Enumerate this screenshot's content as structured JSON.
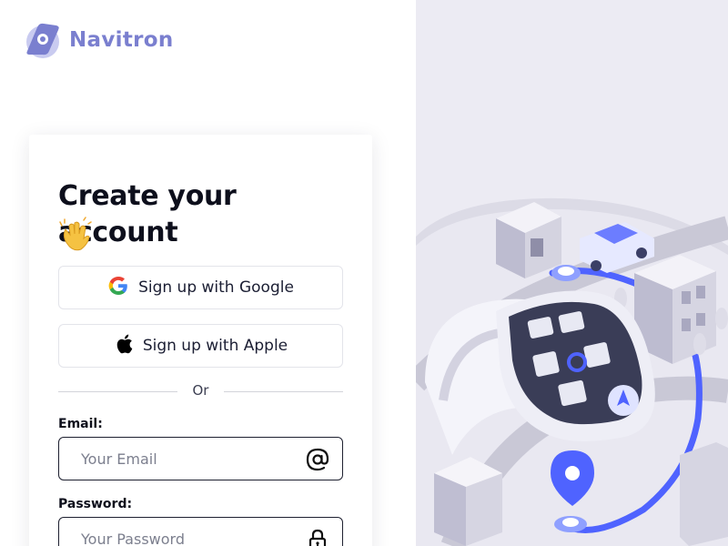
{
  "brand": {
    "name": "Navitron",
    "logo_icon": "navitron-logo-icon",
    "color": "#7a7fcf"
  },
  "signup": {
    "title": "Create your account",
    "title_emoji_icon": "clapping-hands-icon",
    "google_button": {
      "label": "Sign up with Google",
      "icon": "google-icon"
    },
    "apple_button": {
      "label": "Sign up with Apple",
      "icon": "apple-icon"
    },
    "divider_text": "Or",
    "email": {
      "label": "Email:",
      "placeholder": "Your Email",
      "value": "",
      "icon": "at-sign-icon"
    },
    "password": {
      "label": "Password:",
      "placeholder": "Your Password",
      "value": "",
      "icon": "lock-icon"
    }
  },
  "illustration": {
    "name": "isometric-city-smartwatch-navigation-illustration"
  },
  "colors": {
    "accent": "#4f63ff",
    "text": "#0d0f1c",
    "panel_bg": "#ecebf3"
  }
}
